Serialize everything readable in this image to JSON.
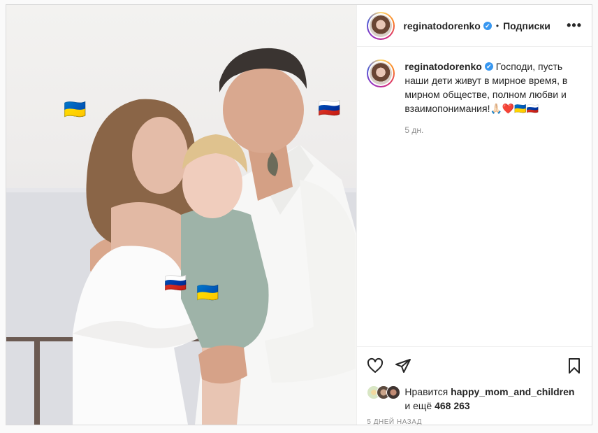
{
  "post": {
    "author": "reginatodorenko",
    "follow_label": "Подписки",
    "separator": "•",
    "more_label": "•••",
    "verified_mark": "✔"
  },
  "photo": {
    "stickers": {
      "ukraine_top": "🇺🇦",
      "russia_top": "🇷🇺",
      "russia_hand": "🇷🇺",
      "ukraine_hand": "🇺🇦"
    }
  },
  "caption": {
    "author": "reginatodorenko",
    "text": "Господи, пусть наши дети живут в мирное время, в мирном обществе, полном любви и взаимопонимания!🙏🏻❤️🇺🇦🇷🇺",
    "time": "5 дн."
  },
  "likes": {
    "prefix": "Нравится",
    "liker": "happy_mom_and_children",
    "and_more": "и ещё",
    "count": "468 263"
  },
  "posted_ago": "5 ДНЕЙ НАЗАД",
  "icons": {
    "like": "heart-outline-icon",
    "share": "paper-plane-icon",
    "save": "bookmark-icon",
    "more": "ellipsis-icon"
  }
}
